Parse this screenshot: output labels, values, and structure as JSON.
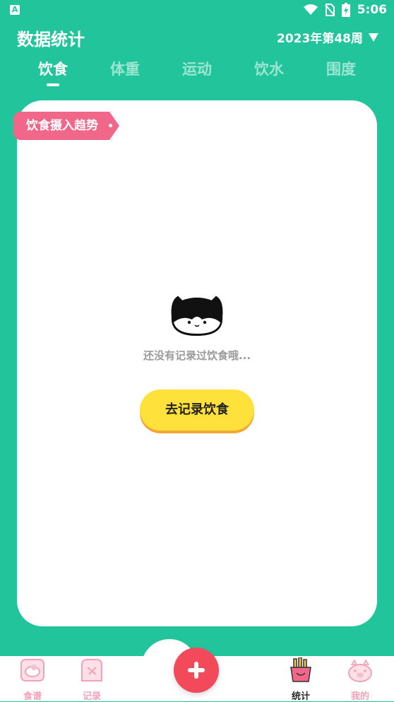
{
  "status": {
    "app_icon": "A",
    "time": "5:06"
  },
  "header": {
    "title": "数据统计",
    "week": "2023年第48周"
  },
  "tabs": [
    "饮食",
    "体重",
    "运动",
    "饮水",
    "围度"
  ],
  "card": {
    "tag": "饮食摄入趋势",
    "empty_text": "还没有记录过饮食哦...",
    "cta": "去记录饮食"
  },
  "nav": {
    "items": [
      {
        "label": "食谱",
        "icon": "recipe-icon"
      },
      {
        "label": "记录",
        "icon": "record-icon"
      },
      {
        "label": "统计",
        "icon": "stats-icon"
      },
      {
        "label": "我的",
        "icon": "profile-icon"
      }
    ],
    "active": "统计"
  },
  "colors": {
    "primary": "#22c59b",
    "accent_pink": "#f0678a",
    "cta_yellow": "#ffe13c",
    "add_red": "#f24a5a"
  }
}
